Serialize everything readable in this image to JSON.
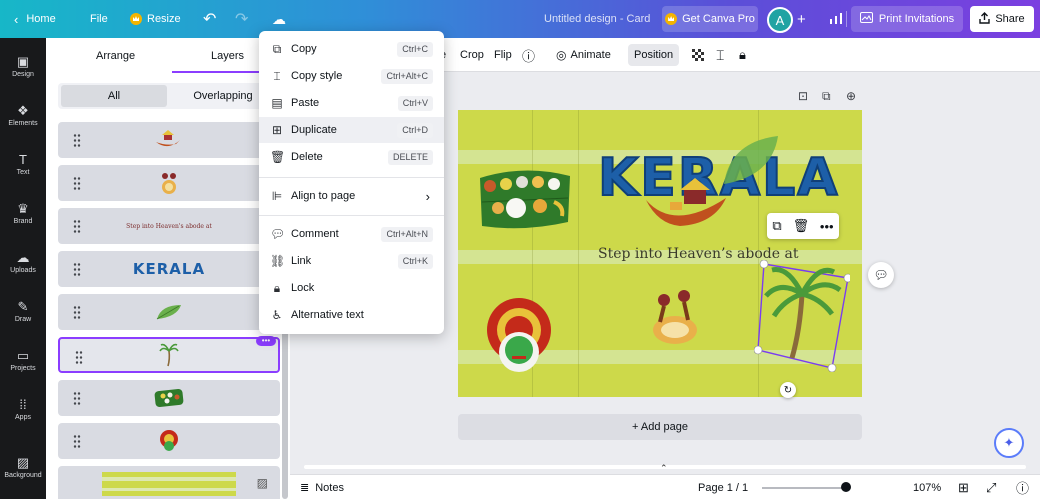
{
  "topbar": {
    "home": "Home",
    "file": "File",
    "resize": "Resize",
    "title": "Untitled design - Card",
    "get_pro": "Get Canva Pro",
    "avatar": "A",
    "print": "Print Invitations",
    "share": "Share",
    "gradient_start": "#17b7c8",
    "gradient_end": "#7b3fe0"
  },
  "rail": {
    "items": [
      {
        "label": "Design",
        "icon": "design-icon"
      },
      {
        "label": "Elements",
        "icon": "elements-icon"
      },
      {
        "label": "Text",
        "icon": "text-icon"
      },
      {
        "label": "Brand",
        "icon": "brand-icon"
      },
      {
        "label": "Uploads",
        "icon": "uploads-icon"
      },
      {
        "label": "Draw",
        "icon": "draw-icon"
      },
      {
        "label": "Projects",
        "icon": "projects-icon"
      },
      {
        "label": "Apps",
        "icon": "apps-icon"
      },
      {
        "label": "Background",
        "icon": "background-icon"
      }
    ]
  },
  "panel": {
    "tab_arrange": "Arrange",
    "tab_layers": "Layers",
    "filter_all": "All",
    "filter_overlapping": "Overlapping",
    "layers": [
      {
        "type": "boat"
      },
      {
        "type": "dancers"
      },
      {
        "type": "tagline",
        "text": "Step into Heaven's abode at"
      },
      {
        "type": "kerala",
        "text": "KERALA"
      },
      {
        "type": "leaf"
      },
      {
        "type": "palm",
        "selected": true,
        "more": "•••"
      },
      {
        "type": "banana-leaf"
      },
      {
        "type": "kathakali"
      },
      {
        "type": "background"
      }
    ],
    "accent": "#8b3dff"
  },
  "toolbar": {
    "crop": "Crop",
    "flip": "Flip",
    "animate": "Animate",
    "position": "Position"
  },
  "canvas": {
    "heading": "KERALA",
    "tagline": "Step into Heaven’s abode at",
    "add_page": "+ Add page",
    "bg_color": "#cdd94a"
  },
  "context_menu": {
    "items": [
      {
        "label": "Copy",
        "shortcut": "Ctrl+C",
        "icon": "copy-icon"
      },
      {
        "label": "Copy style",
        "shortcut": "Ctrl+Alt+C",
        "icon": "paint-roller-icon"
      },
      {
        "label": "Paste",
        "shortcut": "Ctrl+V",
        "icon": "paste-icon"
      },
      {
        "label": "Duplicate",
        "shortcut": "Ctrl+D",
        "icon": "duplicate-icon"
      },
      {
        "label": "Delete",
        "shortcut": "DELETE",
        "icon": "trash-icon"
      },
      {
        "label": "Align to page",
        "icon": "align-icon"
      },
      {
        "label": "Comment",
        "shortcut": "Ctrl+Alt+N",
        "icon": "comment-icon"
      },
      {
        "label": "Link",
        "shortcut": "Ctrl+K",
        "icon": "link-icon"
      },
      {
        "label": "Lock",
        "icon": "lock-icon"
      },
      {
        "label": "Alternative text",
        "icon": "accessibility-icon"
      }
    ]
  },
  "bottombar": {
    "notes": "Notes",
    "page": "Page 1 / 1",
    "zoom": "107%",
    "zoom_level": 0.9
  }
}
